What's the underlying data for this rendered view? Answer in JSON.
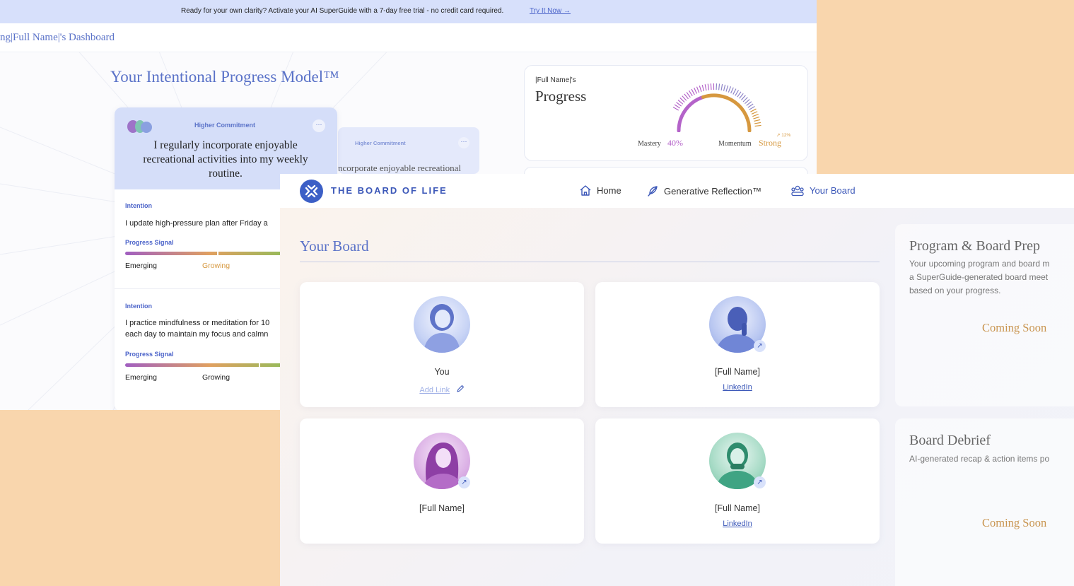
{
  "back": {
    "banner": {
      "text": "Ready for your own clarity? Activate your AI SuperGuide with a 7-day free trial - no credit card required.",
      "link": "Try It Now →"
    },
    "dashboard_title": "ng|Full Name|'s Dashboard",
    "model_title": "Your Intentional Progress Model™",
    "card1": {
      "tag": "Higher Commitment",
      "dots": "···",
      "statement": "I regularly incorporate enjoyable recreational activities into my weekly routine.",
      "intentions": [
        {
          "label": "Intention",
          "text": "I update high-pressure plan after Friday a",
          "signal_label": "Progress Signal",
          "low": "Emerging",
          "mid": "Growing"
        },
        {
          "label": "Intention",
          "text": "I practice mindfulness or meditation for 10 each day to maintain my focus and calmn",
          "signal_label": "Progress Signal",
          "low": "Emerging",
          "mid": "Growing"
        }
      ]
    },
    "card2": {
      "tag": "Higher Commitment",
      "dots": "···",
      "statement": "ncorporate enjoyable recreational"
    },
    "progress": {
      "owner": "|Full Name|'s",
      "title": "Progress",
      "mastery_label": "Mastery",
      "mastery_value": "40%",
      "momentum_label": "Momentum",
      "momentum_value": "Strong",
      "momentum_delta": "↗ 12%",
      "mastery_level": 0.4,
      "colors": {
        "mastery": "#b463c9",
        "momentum": "#d6983f"
      }
    }
  },
  "front": {
    "brand": "THE BOARD OF LIFE",
    "nav": {
      "home": "Home",
      "reflection": "Generative Reflection™",
      "board": "Your Board"
    },
    "board_title": "Your Board",
    "members": [
      {
        "name": "You",
        "link": "Add Link"
      },
      {
        "name": "[Full Name]",
        "link": "LinkedIn"
      },
      {
        "name": "[Full Name]",
        "link": ""
      },
      {
        "name": "[Full Name]",
        "link": "LinkedIn"
      }
    ],
    "side": {
      "prep_title": "Program & Board Prep",
      "prep_desc": [
        "Your upcoming program and board m",
        "a SuperGuide-generated board meet",
        "based on your progress."
      ],
      "prep_status": "Coming Soon",
      "debrief_title": "Board Debrief",
      "debrief_desc": "AI-generated recap & action items po",
      "debrief_status": "Coming Soon"
    }
  }
}
